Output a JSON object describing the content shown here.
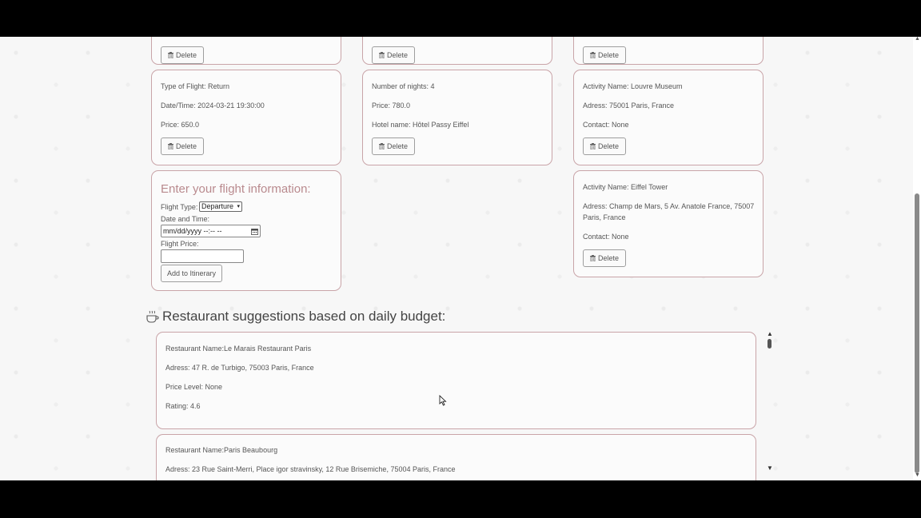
{
  "top_row": {
    "delete_label": "Delete"
  },
  "flight_card": {
    "type": "Type of Flight: Return",
    "datetime": "Date/Time: 2024-03-21 19:30:00",
    "price": "Price: 650.0",
    "delete_label": "Delete"
  },
  "hotel_card": {
    "nights": "Number of nights: 4",
    "price": "Price: 780.0",
    "hotel": "Hotel name: Hôtel Passy Eiffel",
    "delete_label": "Delete"
  },
  "activity_cards": [
    {
      "name": "Activity Name: Louvre Museum",
      "address": "Adress: 75001 Paris, France",
      "contact": "Contact: None",
      "delete_label": "Delete"
    },
    {
      "name": "Activity Name: Eiffel Tower",
      "address_line1": "Adress: Champ de Mars, 5 Av. Anatole France, 75007",
      "address_line2": "Paris, France",
      "contact": "Contact: None",
      "delete_label": "Delete"
    }
  ],
  "flight_form": {
    "title": "Enter your flight information:",
    "type_label": "Flight Type:",
    "type_value": "Departure",
    "date_label": "Date and Time:",
    "date_placeholder": "mm/dd/yyyy --:-- --",
    "price_label": "Flight Price:",
    "price_value": "",
    "add_label": "Add to Itinerary"
  },
  "restaurants": {
    "heading": "Restaurant suggestions based on daily budget:",
    "items": [
      {
        "name": "Restaurant Name:Le Marais Restaurant Paris",
        "address": "Adress: 47 R. de Turbigo, 75003 Paris, France",
        "price_level": "Price Level: None",
        "rating": "Rating: 4.6"
      },
      {
        "name": "Restaurant Name:Paris Beaubourg",
        "address": "Adress: 23 Rue Saint-Merri, Place igor stravinsky, 12 Rue Brisemiche, 75004 Paris, France"
      }
    ]
  },
  "colors": {
    "card_border": "#c9a4a8",
    "accent_title": "#b98a8e",
    "background": "#f7f7f7"
  },
  "icons": {
    "delete": "trash-icon",
    "section": "coffee-cup-icon"
  }
}
